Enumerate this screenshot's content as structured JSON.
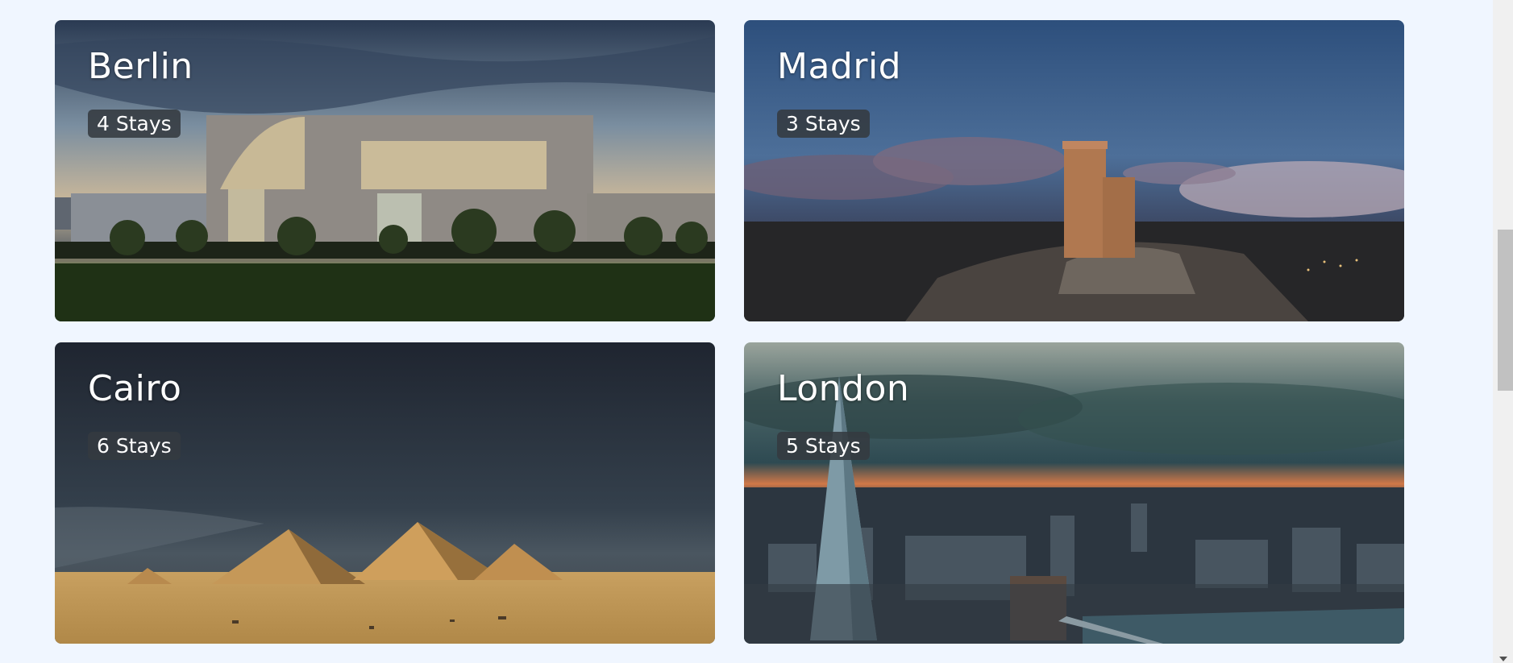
{
  "destinations": [
    {
      "city": "Berlin",
      "stays": "4 Stays"
    },
    {
      "city": "Madrid",
      "stays": "3 Stays"
    },
    {
      "city": "Cairo",
      "stays": "6 Stays"
    },
    {
      "city": "London",
      "stays": "5 Stays"
    }
  ],
  "icons": {
    "scroll_down": "chevron-down-icon"
  },
  "colors": {
    "page_background": "#f0f6ff",
    "badge_background": "#343a40",
    "title_text": "#ffffff"
  }
}
